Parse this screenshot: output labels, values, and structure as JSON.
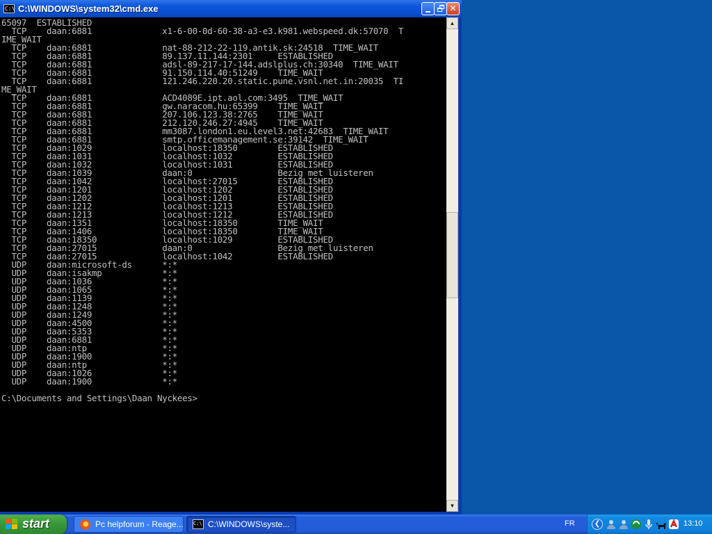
{
  "window": {
    "title": "C:\\WINDOWS\\system32\\cmd.exe",
    "icon": "cmd-icon",
    "icon_glyph": "C:\\"
  },
  "console": {
    "lines": [
      "65097  ESTABLISHED",
      "  TCP    daan:6881              x1-6-00-0d-60-38-a3-e3.k981.webspeed.dk:57070  T",
      "IME_WAIT",
      "  TCP    daan:6881              nat-88-212-22-119.antik.sk:24518  TIME_WAIT",
      "  TCP    daan:6881              89.137.11.144:2301     ESTABLISHED",
      "  TCP    daan:6881              adsl-89-217-17-144.adslplus.ch:30340  TIME_WAIT",
      "  TCP    daan:6881              91.150.114.40:51249    TIME_WAIT",
      "  TCP    daan:6881              121.246.220.20.static.pune.vsnl.net.in:20035  TI",
      "ME_WAIT",
      "  TCP    daan:6881              ACD4089E.ipt.aol.com:3495  TIME_WAIT",
      "  TCP    daan:6881              gw.naracom.hu:65399    TIME_WAIT",
      "  TCP    daan:6881              207.106.123.38:2765    TIME_WAIT",
      "  TCP    daan:6881              212.120.246.27:4945    TIME_WAIT",
      "  TCP    daan:6881              mm3087.london1.eu.level3.net:42683  TIME_WAIT",
      "  TCP    daan:6881              smtp.officemanagement.se:39142  TIME_WAIT",
      "  TCP    daan:1029              localhost:18350        ESTABLISHED",
      "  TCP    daan:1031              localhost:1032         ESTABLISHED",
      "  TCP    daan:1032              localhost:1031         ESTABLISHED",
      "  TCP    daan:1039              daan:0                 Bezig met luisteren",
      "  TCP    daan:1042              localhost:27015        ESTABLISHED",
      "  TCP    daan:1201              localhost:1202         ESTABLISHED",
      "  TCP    daan:1202              localhost:1201         ESTABLISHED",
      "  TCP    daan:1212              localhost:1213         ESTABLISHED",
      "  TCP    daan:1213              localhost:1212         ESTABLISHED",
      "  TCP    daan:1351              localhost:18350        TIME_WAIT",
      "  TCP    daan:1406              localhost:18350        TIME_WAIT",
      "  TCP    daan:18350             localhost:1029         ESTABLISHED",
      "  TCP    daan:27015             daan:0                 Bezig met luisteren",
      "  TCP    daan:27015             localhost:1042         ESTABLISHED",
      "  UDP    daan:microsoft-ds      *:*",
      "  UDP    daan:isakmp            *:*",
      "  UDP    daan:1036              *:*",
      "  UDP    daan:1065              *:*",
      "  UDP    daan:1139              *:*",
      "  UDP    daan:1248              *:*",
      "  UDP    daan:1249              *:*",
      "  UDP    daan:4500              *:*",
      "  UDP    daan:5353              *:*",
      "  UDP    daan:6881              *:*",
      "  UDP    daan:ntp               *:*",
      "  UDP    daan:1900              *:*",
      "  UDP    daan:ntp               *:*",
      "  UDP    daan:1026              *:*",
      "  UDP    daan:1900              *:*",
      "",
      "C:\\Documents and Settings\\Daan Nyckees>"
    ]
  },
  "taskbar": {
    "start_label": "start",
    "tasks": [
      {
        "label": "Pc helpforum - Reage...",
        "icon": "firefox-icon"
      },
      {
        "label": "C:\\WINDOWS\\syste...",
        "icon": "cmd-icon"
      }
    ],
    "language": "FR",
    "clock": "13:10",
    "tray_icons": [
      "show-hidden-icons-chevron",
      "users-icon",
      "users-icon",
      "network-icon",
      "microphone-icon",
      "dog-icon",
      "antivirus-icon"
    ]
  },
  "colors": {
    "titlebar": "#0c56db",
    "console_bg": "#000000",
    "console_text": "#c0c0c0",
    "desktop": "#0a56a8",
    "start_green": "#37973a",
    "tray_blue": "#0f7fdb"
  }
}
